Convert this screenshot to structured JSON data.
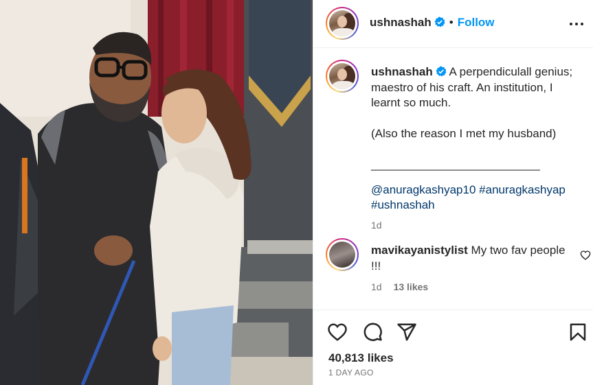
{
  "post": {
    "author": "ushnashah",
    "follow_label": "Follow",
    "separator": "•"
  },
  "caption": {
    "author": "ushnashah",
    "line1": "A perpendiculall genius;",
    "line2": "maestro of his craft. An institution, I",
    "line3": "learnt so much.",
    "line4": "(Also the reason I met my husband)",
    "divider": "__________________________",
    "tag1": "@anuragkashyap10",
    "tag2": "#anuragkashyap",
    "tag3": "#ushnashah",
    "age": "1d"
  },
  "comment": {
    "author": "mavikayanistylist",
    "text_line1": "My two fav people",
    "text_line2": "!!!",
    "age": "1d",
    "likes": "13 likes"
  },
  "footer": {
    "likes": "40,813 likes",
    "date": "1 DAY AGO"
  },
  "icons": {
    "verified": "verified-badge-icon",
    "more": "more-options-icon",
    "like": "heart-icon",
    "comment": "comment-icon",
    "share": "share-icon",
    "save": "bookmark-icon"
  },
  "colors": {
    "accent": "#0095f6",
    "text": "#262626",
    "muted": "#737373",
    "tag": "#00376b"
  }
}
